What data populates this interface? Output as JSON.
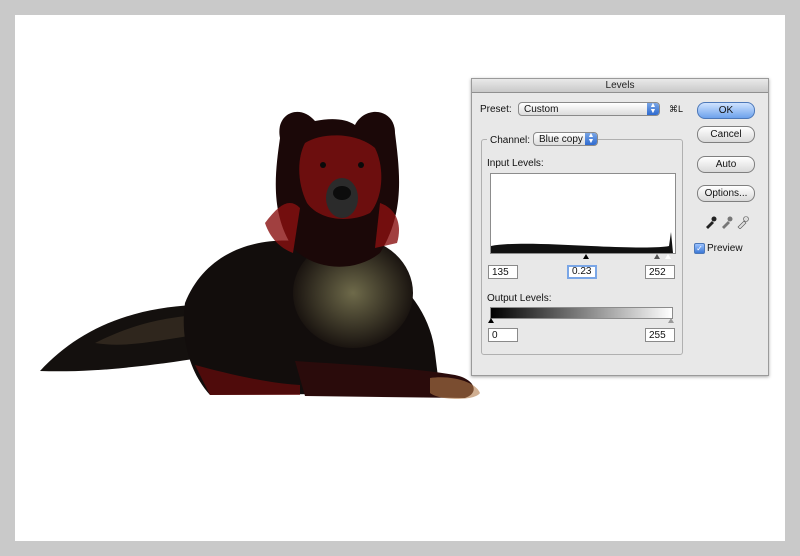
{
  "dialog": {
    "title": "Levels",
    "preset_label": "Preset:",
    "preset_value": "Custom",
    "preset_shortcut": "⌘L",
    "channel_label": "Channel:",
    "channel_value": "Blue copy",
    "input_levels_label": "Input Levels:",
    "input_black": "135",
    "input_gamma": "0.23",
    "input_white": "252",
    "output_levels_label": "Output Levels:",
    "output_black": "0",
    "output_white": "255",
    "buttons": {
      "ok": "OK",
      "cancel": "Cancel",
      "auto": "Auto",
      "options": "Options..."
    },
    "preview_label": "Preview",
    "preview_checked": true
  },
  "icons": [
    "dog-photo",
    "stepper-icon",
    "eyedropper-black-icon",
    "eyedropper-gray-icon",
    "eyedropper-white-icon",
    "checkmark-icon"
  ]
}
